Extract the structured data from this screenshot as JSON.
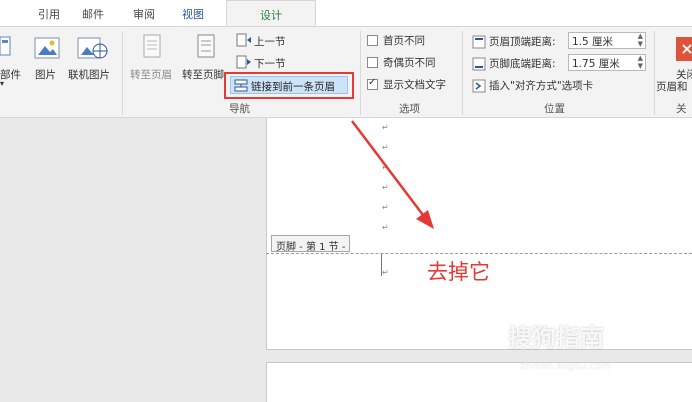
{
  "tabs": {
    "items": [
      "引用",
      "邮件",
      "审阅",
      "视图"
    ],
    "active": "设计"
  },
  "ribbon": {
    "insert": {
      "parts_partial": "部件",
      "picture": "图片",
      "online_picture": "联机图片",
      "dropdown_marker": "▾"
    },
    "nav": {
      "goto_header": "转至页眉",
      "goto_footer": "转至页脚",
      "prev_section": "上一节",
      "next_section": "下一节",
      "link_previous": "链接到前一条页眉",
      "group_label": "导航"
    },
    "options": {
      "different_first_page": "首页不同",
      "different_odd_even": "奇偶页不同",
      "show_document_text": "显示文档文字",
      "group_label": "选项",
      "different_first_page_checked": false,
      "different_odd_even_checked": false,
      "show_document_text_checked": true
    },
    "position": {
      "header_from_top_label": "页眉顶端距离:",
      "header_from_top_value": "1.5 厘米",
      "footer_from_bottom_label": "页脚底端距离:",
      "footer_from_bottom_value": "1.75 厘米",
      "insert_alignment_tab": "插入\"对齐方式\"选项卡",
      "group_label": "位置"
    },
    "close": {
      "label_line1": "关闭",
      "label_line2": "页眉和",
      "group_label": "关闭"
    }
  },
  "document": {
    "footer_tag": "页脚 - 第 1 节 -",
    "paragraph_mark": "↵"
  },
  "annotation": {
    "text": "去掉它",
    "color": "#e53935"
  },
  "watermark": {
    "text": "搜狗指南",
    "url": "zhinan.sogou.com"
  },
  "colors": {
    "active_tab_text": "#2f7a3a",
    "view_tab_text": "#2b579a",
    "highlight_button": "#cde3f7",
    "annotation_red": "#e53935",
    "close_button": "#e0533b"
  }
}
